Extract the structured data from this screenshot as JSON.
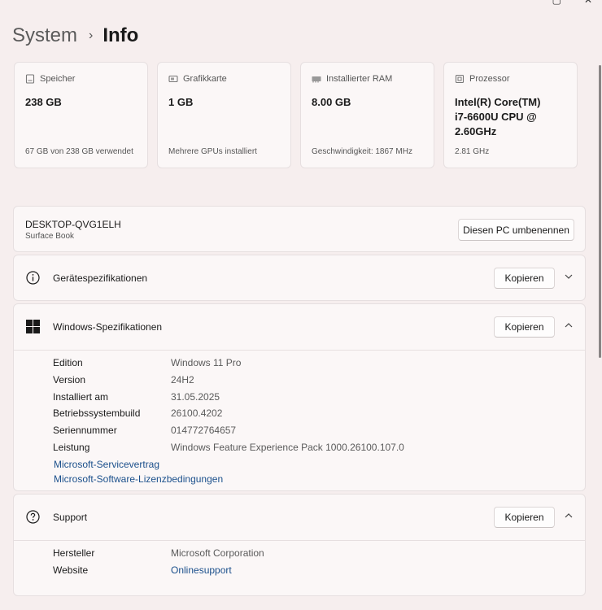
{
  "window": {
    "minimize_glyph": "▢",
    "close_glyph": "✕"
  },
  "breadcrumb": {
    "parent": "System",
    "separator": "›",
    "current": "Info"
  },
  "cards": [
    {
      "icon": "storage-icon",
      "title": "Speicher",
      "value": "238 GB",
      "sub": "67 GB von 238 GB verwendet"
    },
    {
      "icon": "gpu-icon",
      "title": "Grafikkarte",
      "value": "1 GB",
      "sub": "Mehrere GPUs installiert"
    },
    {
      "icon": "ram-icon",
      "title": "Installierter RAM",
      "value": "8.00 GB",
      "sub": "Geschwindigkeit: 1867 MHz"
    },
    {
      "icon": "processor-icon",
      "title": "Prozessor",
      "value": "Intel(R) Core(TM) i7-6600U CPU @ 2.60GHz",
      "sub": "2.81 GHz"
    }
  ],
  "device": {
    "name": "DESKTOP-QVG1ELH",
    "model": "Surface Book",
    "rename_label": "Diesen PC umbenennen"
  },
  "sections": {
    "geraete": {
      "title": "Gerätespezifikationen",
      "copy_label": "Kopieren",
      "expanded": false
    },
    "windows": {
      "title": "Windows-Spezifikationen",
      "copy_label": "Kopieren",
      "expanded": true,
      "rows": [
        {
          "label": "Edition",
          "value": "Windows 11 Pro"
        },
        {
          "label": "Version",
          "value": "24H2"
        },
        {
          "label": "Installiert am",
          "value": "31.05.2025"
        },
        {
          "label": "Betriebssystembuild",
          "value": "26100.4202"
        },
        {
          "label": "Seriennummer",
          "value": "014772764657"
        },
        {
          "label": "Leistung",
          "value": "Windows Feature Experience Pack 1000.26100.107.0"
        }
      ],
      "links": [
        "Microsoft-Servicevertrag",
        "Microsoft-Software-Lizenzbedingungen"
      ]
    },
    "support": {
      "title": "Support",
      "copy_label": "Kopieren",
      "expanded": true,
      "rows": [
        {
          "label": "Hersteller",
          "value": "Microsoft Corporation"
        },
        {
          "label": "Website",
          "value": "Onlinesupport"
        }
      ]
    }
  },
  "colors": {
    "background": "#f6eeee",
    "card": "#fbf7f7",
    "link": "#1a4f8b"
  }
}
